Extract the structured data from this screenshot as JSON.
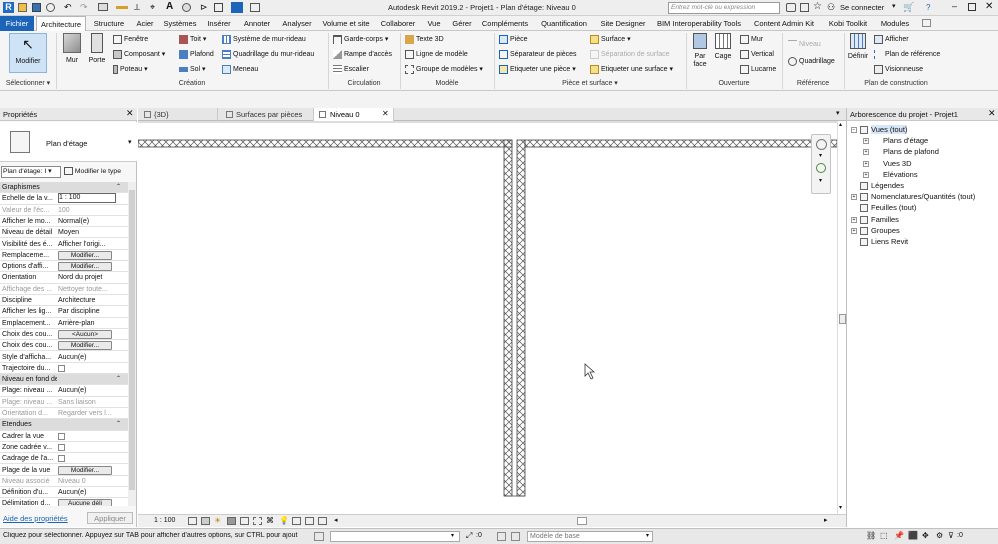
{
  "titlebar": {
    "app_title": "Autodesk Revit 2019.2 - Projet1 - Plan d'étage: Niveau 0",
    "search_placeholder": "Entrez mot-clé ou expression",
    "sign_in": "Se connecter",
    "help": "?"
  },
  "menu": {
    "tabs": [
      "Fichier",
      "Architecture",
      "Structure",
      "Acier",
      "Systèmes",
      "Insérer",
      "Annoter",
      "Analyser",
      "Volume et site",
      "Collaborer",
      "Vue",
      "Gérer",
      "Compléments",
      "Quantification",
      "Site Designer",
      "BIM Interoperability Tools",
      "Content Admin Kit",
      "Kobi Toolkit",
      "Modules"
    ],
    "active": "Architecture"
  },
  "ribbon": {
    "select": {
      "modify": "Modifier",
      "footer": "Sélectionner ▾"
    },
    "build": {
      "wall": "Mur",
      "door": "Porte",
      "col1": [
        "Fenêtre",
        "Composant ▾",
        "Poteau ▾"
      ],
      "col2": [
        "Toit ▾",
        "Plafond",
        "Sol ▾"
      ],
      "col3": [
        "Système de mur-rideau",
        "Quadrillage du mur-rideau",
        "Meneau"
      ],
      "footer": "Création"
    },
    "circulation": {
      "items": [
        "Garde-corps ▾",
        "Rampe d'accès",
        "Escalier"
      ],
      "footer": "Circulation"
    },
    "model": {
      "items": [
        "Texte 3D",
        "Ligne de modèle",
        "Groupe de modèles ▾"
      ],
      "footer": "Modèle"
    },
    "room": {
      "col1": [
        "Pièce",
        "Séparateur de pièces",
        "Etiqueter une pièce ▾"
      ],
      "col2": [
        "Surface ▾",
        "Séparation de surface",
        "Etiqueter une surface ▾"
      ],
      "footer": "Pièce et surface ▾"
    },
    "opening": {
      "face": "Par face",
      "shaft": "Cage",
      "items": [
        "Mur",
        "Vertical",
        "Lucarne"
      ],
      "footer": "Ouverture"
    },
    "datum": {
      "items": [
        "Niveau",
        "Quadrillage"
      ],
      "footer": "Référence"
    },
    "workplane": {
      "define": "Définir",
      "items": [
        "Afficher",
        "Plan de référence",
        "Visionneuse"
      ],
      "footer": "Plan de construction"
    }
  },
  "properties": {
    "title": "Propriétés",
    "type_name": "Plan d'étage",
    "instance_selector": "Plan d'étage: I ▾",
    "edit_type": "Modifier le type",
    "rows": [
      {
        "k": "Graphismes",
        "sec": true
      },
      {
        "k": "Echelle de la v...",
        "v": "1 : 100",
        "input": true
      },
      {
        "k": "Valeur de l'éc...",
        "v": "100",
        "grey": true
      },
      {
        "k": "Afficher le mo...",
        "v": "Normal(e)"
      },
      {
        "k": "Niveau de détail",
        "v": "Moyen"
      },
      {
        "k": "Visibilité des é...",
        "v": "Afficher l'origi..."
      },
      {
        "k": "Remplaceme...",
        "v": "Modifier...",
        "btn": true
      },
      {
        "k": "Options d'affi...",
        "v": "Modifier...",
        "btn": true
      },
      {
        "k": "Orientation",
        "v": "Nord du projet"
      },
      {
        "k": "Affichage des ...",
        "v": "Nettoyer toute...",
        "grey": true
      },
      {
        "k": "Discipline",
        "v": "Architecture"
      },
      {
        "k": "Afficher les lig...",
        "v": "Par discipline"
      },
      {
        "k": "Emplacement...",
        "v": "Arrière-plan"
      },
      {
        "k": "Choix des cou...",
        "v": "<Aucun>",
        "btn": true
      },
      {
        "k": "Choix des cou...",
        "v": "Modifier...",
        "btn": true
      },
      {
        "k": "Style d'afficha...",
        "v": "Aucun(e)"
      },
      {
        "k": "Trajectoire du...",
        "chk": true
      },
      {
        "k": "Niveau en fond de plan",
        "sec": true
      },
      {
        "k": "Plage: niveau ...",
        "v": "Aucun(e)"
      },
      {
        "k": "Plage: niveau ...",
        "v": "Sans liaison",
        "grey": true
      },
      {
        "k": "Orientation d...",
        "v": "Regarder vers l...",
        "grey": true
      },
      {
        "k": "Etendues",
        "sec": true
      },
      {
        "k": "Cadrer la vue",
        "chk": true
      },
      {
        "k": "Zone cadrée v...",
        "chk": true
      },
      {
        "k": "Cadrage de l'a...",
        "chk": true
      },
      {
        "k": "Plage de la vue",
        "v": "Modifier...",
        "btn": true
      },
      {
        "k": "Niveau associé",
        "v": "Niveau 0",
        "grey": true
      },
      {
        "k": "Définition d'u...",
        "v": "Aucun(e)"
      },
      {
        "k": "Délimitation d...",
        "v": "Aucune déli",
        "btn": true
      }
    ],
    "help_link": "Aide des propriétés",
    "apply": "Appliquer"
  },
  "view_tabs": [
    {
      "label": "{3D}",
      "active": false
    },
    {
      "label": "Surfaces par pièces",
      "active": false
    },
    {
      "label": "Niveau 0",
      "active": true
    }
  ],
  "view_control": {
    "scale": "1 : 100"
  },
  "browser": {
    "title": "Arborescence du projet - Projet1",
    "items": [
      {
        "label": "Vues (tout)",
        "level": 0,
        "sel": true
      },
      {
        "label": "Plans d'étage",
        "level": 1
      },
      {
        "label": "Plans de plafond",
        "level": 1
      },
      {
        "label": "Vues 3D",
        "level": 1
      },
      {
        "label": "Elévations",
        "level": 1
      },
      {
        "label": "Légendes",
        "level": 0
      },
      {
        "label": "Nomenclatures/Quantités (tout)",
        "level": 0
      },
      {
        "label": "Feuilles (tout)",
        "level": 0
      },
      {
        "label": "Familles",
        "level": 0
      },
      {
        "label": "Groupes",
        "level": 0
      },
      {
        "label": "Liens Revit",
        "level": 0
      }
    ]
  },
  "status": {
    "message": "Cliquez pour sélectionner. Appuyez sur TAB pour afficher d'autres options, sur CTRL pour ajout",
    "workset_count": ":0",
    "model": "Modèle de base",
    "filter_count": ":0"
  },
  "colors": {
    "file_tab": "#1b64b8",
    "accent": "#2a6fc2",
    "wall_hatch": "#555555"
  }
}
